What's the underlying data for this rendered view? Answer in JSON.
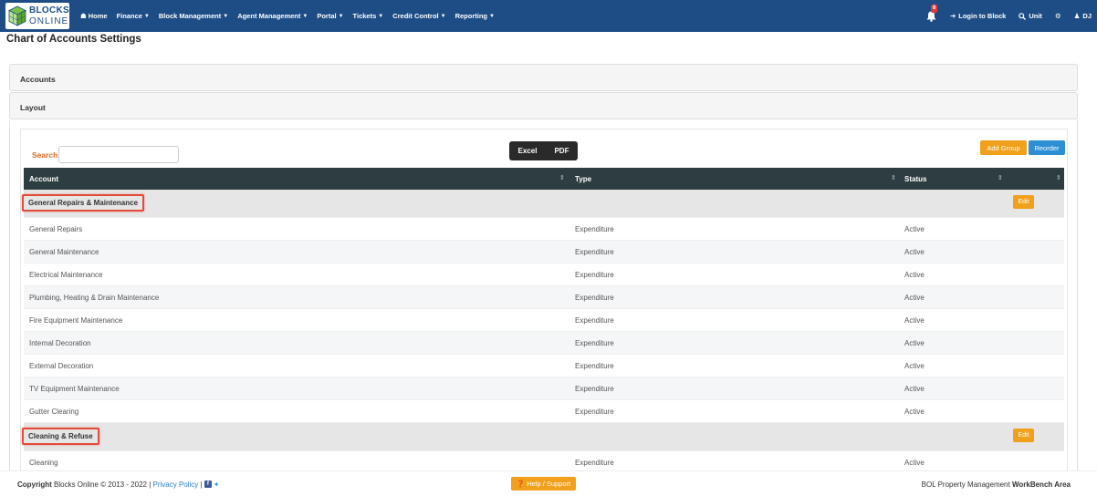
{
  "brand": {
    "line1": "BLOCKS",
    "line2": "ONLINE"
  },
  "nav": {
    "items": [
      {
        "label": "Home",
        "has_dropdown": false
      },
      {
        "label": "Finance",
        "has_dropdown": true
      },
      {
        "label": "Block Management",
        "has_dropdown": true
      },
      {
        "label": "Agent Management",
        "has_dropdown": true
      },
      {
        "label": "Portal",
        "has_dropdown": true
      },
      {
        "label": "Tickets",
        "has_dropdown": true
      },
      {
        "label": "Credit Control",
        "has_dropdown": true
      },
      {
        "label": "Reporting",
        "has_dropdown": true
      }
    ],
    "notification_count": "6",
    "login_label": "Login to Block",
    "unit_label": "Unit",
    "user_initials": "DJ"
  },
  "page": {
    "title": "Chart of Accounts Settings"
  },
  "panels": {
    "accounts": "Accounts",
    "layout": "Layout"
  },
  "toolbar": {
    "search_label": "Search",
    "search_value": "",
    "search_placeholder": "",
    "excel": "Excel",
    "pdf": "PDF",
    "add_group": "Add Group",
    "reorder": "Reorder"
  },
  "table": {
    "headers": {
      "account": "Account",
      "type": "Type",
      "status": "Status"
    },
    "edit_label": "Edit",
    "rows": [
      {
        "kind": "group",
        "label": "General Repairs & Maintenance"
      },
      {
        "kind": "item",
        "account": "General Repairs",
        "type": "Expenditure",
        "status": "Active"
      },
      {
        "kind": "item",
        "account": "General Maintenance",
        "type": "Expenditure",
        "status": "Active"
      },
      {
        "kind": "item",
        "account": "Electrical Maintenance",
        "type": "Expenditure",
        "status": "Active"
      },
      {
        "kind": "item",
        "account": "Plumbing, Heating & Drain Maintenance",
        "type": "Expenditure",
        "status": "Active"
      },
      {
        "kind": "item",
        "account": "Fire Equipment Maintenance",
        "type": "Expenditure",
        "status": "Active"
      },
      {
        "kind": "item",
        "account": "Internal Decoration",
        "type": "Expenditure",
        "status": "Active"
      },
      {
        "kind": "item",
        "account": "External Decoration",
        "type": "Expenditure",
        "status": "Active"
      },
      {
        "kind": "item",
        "account": "TV Equipment Maintenance",
        "type": "Expenditure",
        "status": "Active"
      },
      {
        "kind": "item",
        "account": "Gutter Clearing",
        "type": "Expenditure",
        "status": "Active"
      },
      {
        "kind": "group",
        "label": "Cleaning & Refuse"
      },
      {
        "kind": "item",
        "account": "Cleaning",
        "type": "Expenditure",
        "status": "Active"
      }
    ]
  },
  "footer": {
    "copyright_bold": "Copyright",
    "copyright_text": "Blocks Online © 2013 - 2022 |",
    "privacy": "Privacy Policy",
    "separator": "|",
    "help": "Help / Support",
    "right_text": "BOL Property Management",
    "right_bold": "WorkBench Area"
  },
  "colors": {
    "navbar": "#1e4d86",
    "table_header": "#2e3d42",
    "accent_orange": "#f0a01a",
    "accent_blue": "#2c8fd6",
    "highlight_red": "#e34a3a"
  }
}
